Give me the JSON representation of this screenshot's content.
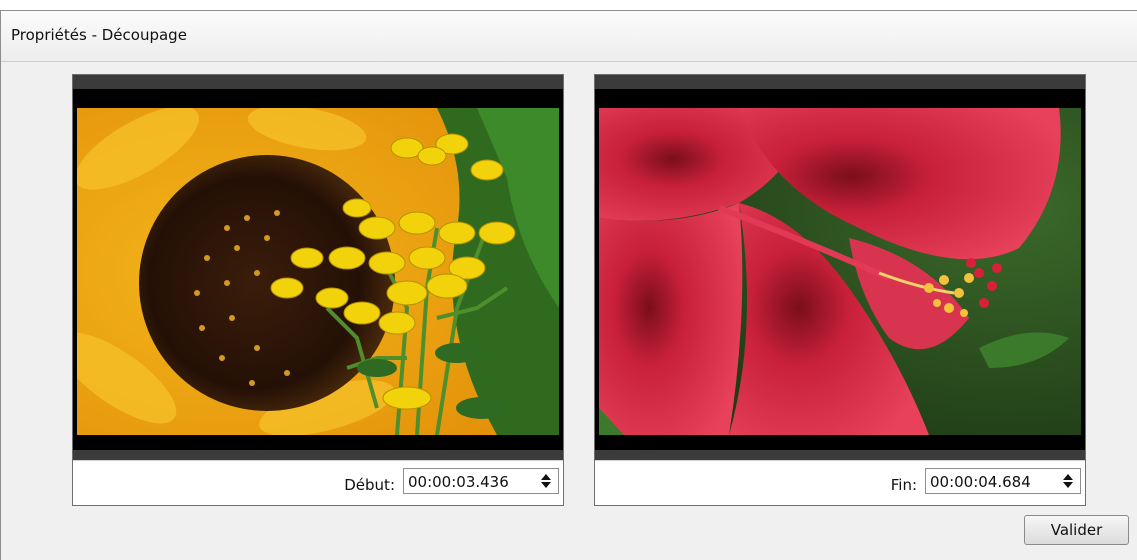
{
  "window": {
    "title": "Propriétés - Découpage"
  },
  "start_panel": {
    "label": "Début:",
    "time_value": "00:00:03.436",
    "preview": "sunflower-and-tansy-image"
  },
  "end_panel": {
    "label": "Fin:",
    "time_value": "00:00:04.684",
    "preview": "red-hibiscus-image"
  },
  "actions": {
    "validate_label": "Valider"
  },
  "icons": {
    "spinner": "spin-arrows-icon"
  },
  "colors": {
    "window_bg": "#f0f0f0",
    "border": "#6f6f6f",
    "letterbox": "#000000"
  }
}
